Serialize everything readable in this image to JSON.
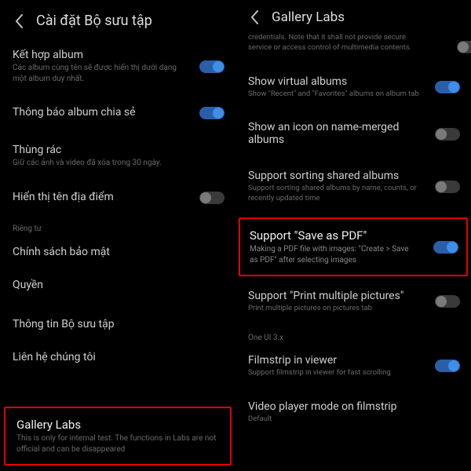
{
  "left": {
    "header_title": "Cài đặt Bộ sưu tập",
    "items": {
      "merge_album": {
        "title": "Kết hợp album",
        "subtitle": "Các album cùng tên sẽ được hiển thị dưới dạng một album duy nhất."
      },
      "shared_notify": {
        "title": "Thông báo album chia sẻ"
      },
      "trash": {
        "title": "Thùng rác",
        "subtitle": "Giữ các ảnh và video đã xóa trong 30 ngày."
      },
      "location_names": {
        "title": "Hiển thị tên địa điểm"
      },
      "privacy_label": "Riêng tư",
      "privacy_policy": {
        "title": "Chính sách bảo mật"
      },
      "permissions": {
        "title": "Quyền"
      },
      "about": {
        "title": "Thông tin Bộ sưu tập"
      },
      "contact": {
        "title": "Liên hệ chúng tôi"
      },
      "gallery_labs": {
        "title": "Gallery Labs",
        "subtitle": "This is only for internal test. The functions in Labs are not official and can be disappeared"
      }
    }
  },
  "right": {
    "header_title": "Gallery Labs",
    "items": {
      "credentials": {
        "subtitle": "credentials. Note that it shall not provide secure service or access control of multimedia contents."
      },
      "virtual_albums": {
        "title": "Show virtual albums",
        "subtitle": "Show \"Recent\" and \"Favorites\" albums on album tab"
      },
      "icon_merged": {
        "title": "Show an icon on name-merged albums"
      },
      "sort_shared": {
        "title": "Support sorting shared albums",
        "subtitle": "Support sorting shared albums by name, counts, or recently updated time"
      },
      "save_pdf": {
        "title": "Support \"Save as PDF\"",
        "subtitle": "Making a PDF file with images: \"Create > Save as PDF\" after selecting images"
      },
      "print_multiple": {
        "title": "Support \"Print multiple pictures\"",
        "subtitle": "Print multiple pictures on pictures tab"
      },
      "oneui_label": "One UI 3.x",
      "filmstrip": {
        "title": "Filmstrip in viewer",
        "subtitle": "Support filmstrip in viewer for fast scrolling"
      },
      "video_filmstrip": {
        "title": "Video player mode on filmstrip",
        "subtitle": "Default"
      }
    }
  }
}
